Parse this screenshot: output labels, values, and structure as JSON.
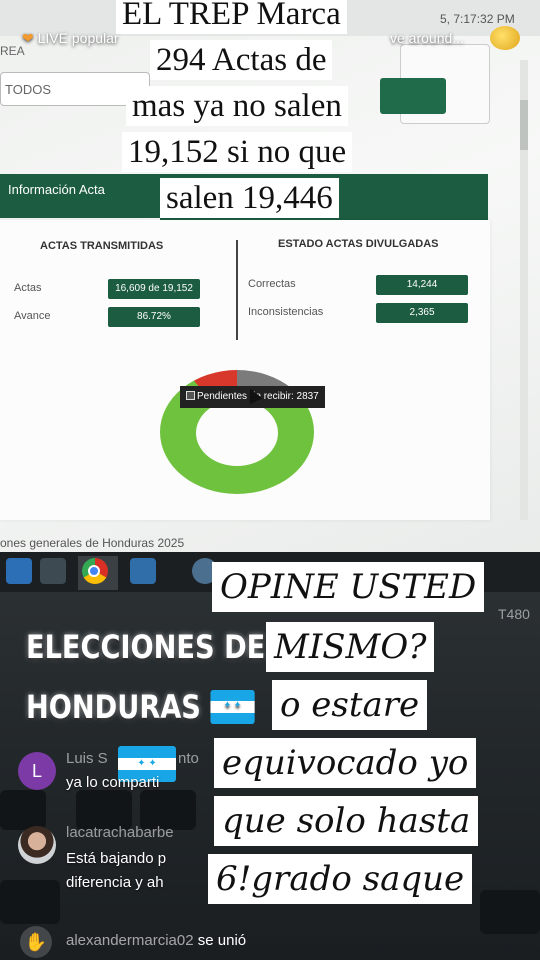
{
  "overlay_title": {
    "lines": [
      "EL TREP Marca",
      "294 Actas de",
      "mas ya no salen",
      "19,152  si no que",
      "salen 19,446"
    ]
  },
  "overlay_opinion": {
    "lines": [
      "OPINE USTED",
      "MISMO?",
      "o estare",
      "equivocado yo",
      "que solo hasta",
      "6!grado saque"
    ]
  },
  "headline": {
    "line1": "ELECCIONES DE",
    "line2": "HONDURAS"
  },
  "live_banner": {
    "text": "LIVE popular",
    "right_text": "ve around...",
    "clock": "5, 7:17:32 PM"
  },
  "dashboard": {
    "area_label": "REA",
    "filter_value": "TODOS",
    "tab_label": "Información Acta",
    "actas_transmitidas": {
      "title": "ACTAS TRANSMITIDAS",
      "rows": [
        {
          "label": "Actas",
          "value": "16,609 de 19,152"
        },
        {
          "label": "Avance",
          "value": "86.72%"
        }
      ]
    },
    "estado_actas": {
      "title": "ESTADO ACTAS DIVULGADAS",
      "rows": [
        {
          "label": "Correctas",
          "value": "14,244"
        },
        {
          "label": "Inconsistencias",
          "value": "2,365"
        }
      ]
    },
    "tooltip": "Pendientes de recibir: 2837",
    "footer": "ones generales de Honduras 2025"
  },
  "laptop": {
    "model": "T480"
  },
  "comments": [
    {
      "name": "Luis S",
      "name_suffix": "nto",
      "text": "ya lo comparti",
      "avatar_letter": "L"
    },
    {
      "name": "lacatrachabarbe",
      "text_line1": "Está bajando p",
      "text_line2": "diferencia y ah"
    }
  ],
  "join_event": {
    "user": "alexandermarcia02",
    "action": "se unió"
  },
  "colors": {
    "dashboard_green": "#1c5c41",
    "donut_green": "#6fc23e",
    "donut_red": "#d8372b",
    "donut_gray": "#7b7b7b",
    "flag_blue": "#18a6e6"
  }
}
